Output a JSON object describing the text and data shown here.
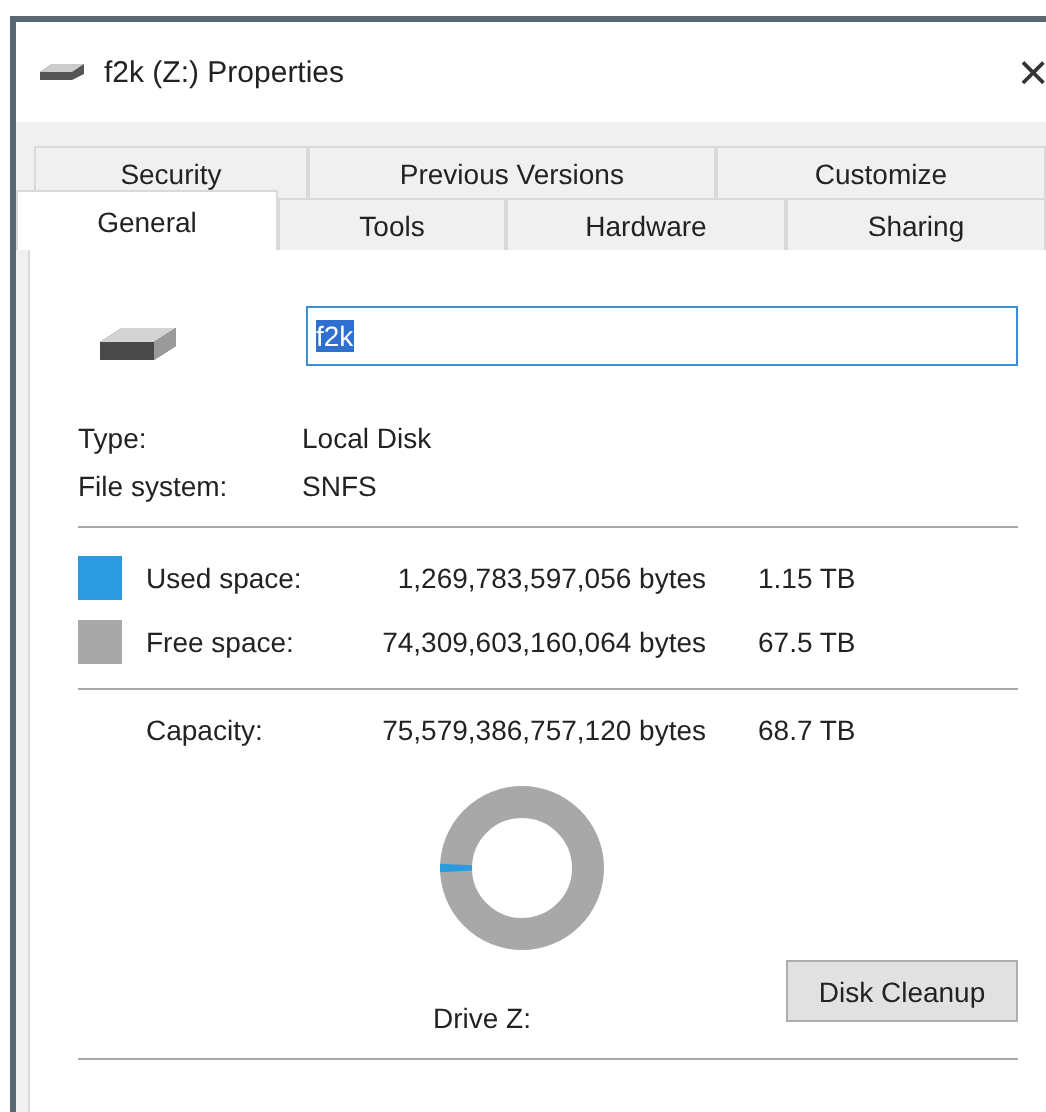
{
  "window": {
    "title": "f2k (Z:) Properties",
    "close": "×"
  },
  "tab_rows": [
    [
      {
        "label": "Security",
        "selected": false
      },
      {
        "label": "Previous Versions",
        "selected": false
      },
      {
        "label": "Customize",
        "selected": false
      }
    ],
    [
      {
        "label": "General",
        "selected": true
      },
      {
        "label": "Tools",
        "selected": false
      },
      {
        "label": "Hardware",
        "selected": false
      },
      {
        "label": "Sharing",
        "selected": false
      }
    ]
  ],
  "name_field": {
    "value": "f2k",
    "highlighted": true
  },
  "info": [
    {
      "label": "Type:",
      "value": "Local Disk"
    },
    {
      "label": "File system:",
      "value": "SNFS"
    }
  ],
  "space": [
    {
      "label": "Used space:",
      "bytes": "1,269,783,597,056 bytes",
      "size": "1.15 TB",
      "color": "#2b9be0"
    },
    {
      "label": "Free space:",
      "bytes": "74,309,603,160,064 bytes",
      "size": "67.5 TB",
      "color": "#a8a8a8"
    }
  ],
  "capacity": {
    "label": "Capacity:",
    "bytes": "75,579,386,757,120 bytes",
    "size": "68.7 TB"
  },
  "usage_ring": {
    "level": 0.017
  },
  "drive_label": "Drive Z:",
  "cleanup_button": "Disk Cleanup"
}
